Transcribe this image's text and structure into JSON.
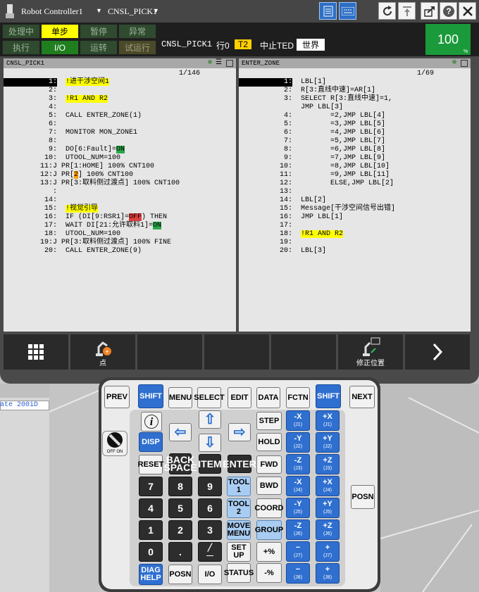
{
  "titlebar": {
    "controller": "Robot Controller1",
    "program": "CNSL_PICK1"
  },
  "status": {
    "row1": [
      "处理中",
      "单步",
      "暂停",
      "异常"
    ],
    "row2": [
      "执行",
      "I/O",
      "运转",
      "试运行"
    ],
    "info_program": "CNSL_PICK1",
    "info_line": "行0",
    "info_mode": "T2",
    "info_state": "中止TED",
    "info_frame": "世界",
    "override": "100",
    "override_unit": "%"
  },
  "left_pane": {
    "title": "CNSL_PICK1",
    "position": "1/146",
    "lines": [
      {
        "n": "1:",
        "t": "  ",
        "h": "!进干涉空间1",
        "cur": true
      },
      {
        "n": "2:",
        "t": ""
      },
      {
        "n": "3:",
        "t": "  ",
        "h": "!R1 AND R2"
      },
      {
        "n": "4:",
        "t": ""
      },
      {
        "n": "5:",
        "t": "  CALL ENTER_ZONE(1)"
      },
      {
        "n": "6:",
        "t": ""
      },
      {
        "n": "7:",
        "t": "  MONITOR MON_ZONE1"
      },
      {
        "n": "8:",
        "t": ""
      },
      {
        "n": "9:",
        "t": "  DO[6:Fault]=",
        "g": "ON"
      },
      {
        "n": "10:",
        "t": "  UTOOL_NUM=100"
      },
      {
        "n": "11:J",
        "t": " PR[1:HOME] 100% CNT100"
      },
      {
        "n": "12:J",
        "t": " PR[",
        "o": "2",
        "t2": "] 100% CNT100"
      },
      {
        "n": "13:J",
        "t": " PR[3:取料侧过渡点] 100% CNT100"
      },
      {
        "n": ":",
        "t": ""
      },
      {
        "n": "14:",
        "t": ""
      },
      {
        "n": "15:",
        "t": "  ",
        "h": "!视觉引导"
      },
      {
        "n": "16:",
        "t": "  IF (DI[9:RSR1]=",
        "r": "OFF",
        "t2": ") THEN"
      },
      {
        "n": "17:",
        "t": "  WAIT DI[21:允许取料1]=",
        "g": "ON"
      },
      {
        "n": "18:",
        "t": "  UTOOL_NUM=100"
      },
      {
        "n": "19:J",
        "t": " PR[3:取料侧过渡点] 100% FINE"
      },
      {
        "n": "20:",
        "t": "  CALL ENTER_ZONE(9)"
      }
    ]
  },
  "right_pane": {
    "title": "ENTER_ZONE",
    "position": "1/69",
    "lines": [
      {
        "n": "1:",
        "t": "  LBL[1]",
        "cur": true
      },
      {
        "n": "2:",
        "t": "  R[3:直线中速]=AR[1]"
      },
      {
        "n": "3:",
        "t": "  SELECT R[3:直线中速]=1,"
      },
      {
        "n": "",
        "t": "  JMP LBL[3]"
      },
      {
        "n": "4:",
        "t": "         =2,JMP LBL[4]"
      },
      {
        "n": "5:",
        "t": "         =3,JMP LBL[5]"
      },
      {
        "n": "6:",
        "t": "         =4,JMP LBL[6]"
      },
      {
        "n": "7:",
        "t": "         =5,JMP LBL[7]"
      },
      {
        "n": "8:",
        "t": "         =6,JMP LBL[8]"
      },
      {
        "n": "9:",
        "t": "         =7,JMP LBL[9]"
      },
      {
        "n": "10:",
        "t": "         =8,JMP LBL[10]"
      },
      {
        "n": "11:",
        "t": "         =9,JMP LBL[11]"
      },
      {
        "n": "12:",
        "t": "         ELSE,JMP LBL[2]"
      },
      {
        "n": "13:",
        "t": ""
      },
      {
        "n": "14:",
        "t": "  LBL[2]"
      },
      {
        "n": "15:",
        "t": "  Message[干涉空间信号出错]"
      },
      {
        "n": "16:",
        "t": "  JMP LBL[1]"
      },
      {
        "n": "17:",
        "t": ""
      },
      {
        "n": "18:",
        "t": "  ",
        "h": "!R1 AND R2"
      },
      {
        "n": "19:",
        "t": ""
      },
      {
        "n": "20:",
        "t": "  LBL[3]"
      }
    ]
  },
  "softkeys": {
    "point_label": "点",
    "touchup_label": "修正位置"
  },
  "keypad": {
    "prev": "PREV",
    "shift": "SHIFT",
    "menu": "MENU",
    "select": "SELECT",
    "edit": "EDIT",
    "data": "DATA",
    "fctn": "FCTN",
    "next": "NEXT",
    "disp": "DISP",
    "reset": "RESET",
    "backspace1": "BACK",
    "backspace2": "SPACE",
    "item": "ITEM",
    "enter": "ENTER",
    "step": "STEP",
    "hold": "HOLD",
    "fwd": "FWD",
    "bwd": "BWD",
    "coord": "COORD",
    "group": "GROUP",
    "tool1a": "TOOL",
    "tool1b": "1",
    "tool2a": "TOOL",
    "tool2b": "2",
    "move1": "MOVE",
    "move2": "MENU",
    "setup1": "SET",
    "setup2": "UP",
    "diag1": "DIAG",
    "diag2": "HELP",
    "posn": "POSN",
    "io": "I/O",
    "status": "STATUS",
    "posn_side": "POSN",
    "off": "OFF",
    "on": "ON",
    "digits": [
      "7",
      "8",
      "9",
      "4",
      "5",
      "6",
      "1",
      "2",
      "3",
      "0",
      "."
    ],
    "plus_pct": "+%",
    "minus_pct": "-%",
    "jog": [
      [
        "-X",
        "(J1)"
      ],
      [
        "+X",
        "(J1)"
      ],
      [
        "-Y",
        "(J2)"
      ],
      [
        "+Y",
        "(J2)"
      ],
      [
        "-Z",
        "(J3)"
      ],
      [
        "+Z",
        "(J3)"
      ],
      [
        "-X",
        "(J4)"
      ],
      [
        "+X",
        "(J4)"
      ],
      [
        "-Y",
        "(J5)"
      ],
      [
        "+Y",
        "(J5)"
      ],
      [
        "-Z",
        "(J6)"
      ],
      [
        "+Z",
        "(J6)"
      ],
      [
        "−",
        "(J7)"
      ],
      [
        "+",
        "(J7)"
      ],
      [
        "−",
        "(J8)"
      ],
      [
        "+",
        "(J8)"
      ]
    ]
  },
  "background": {
    "left_label": "ate 200iD"
  }
}
